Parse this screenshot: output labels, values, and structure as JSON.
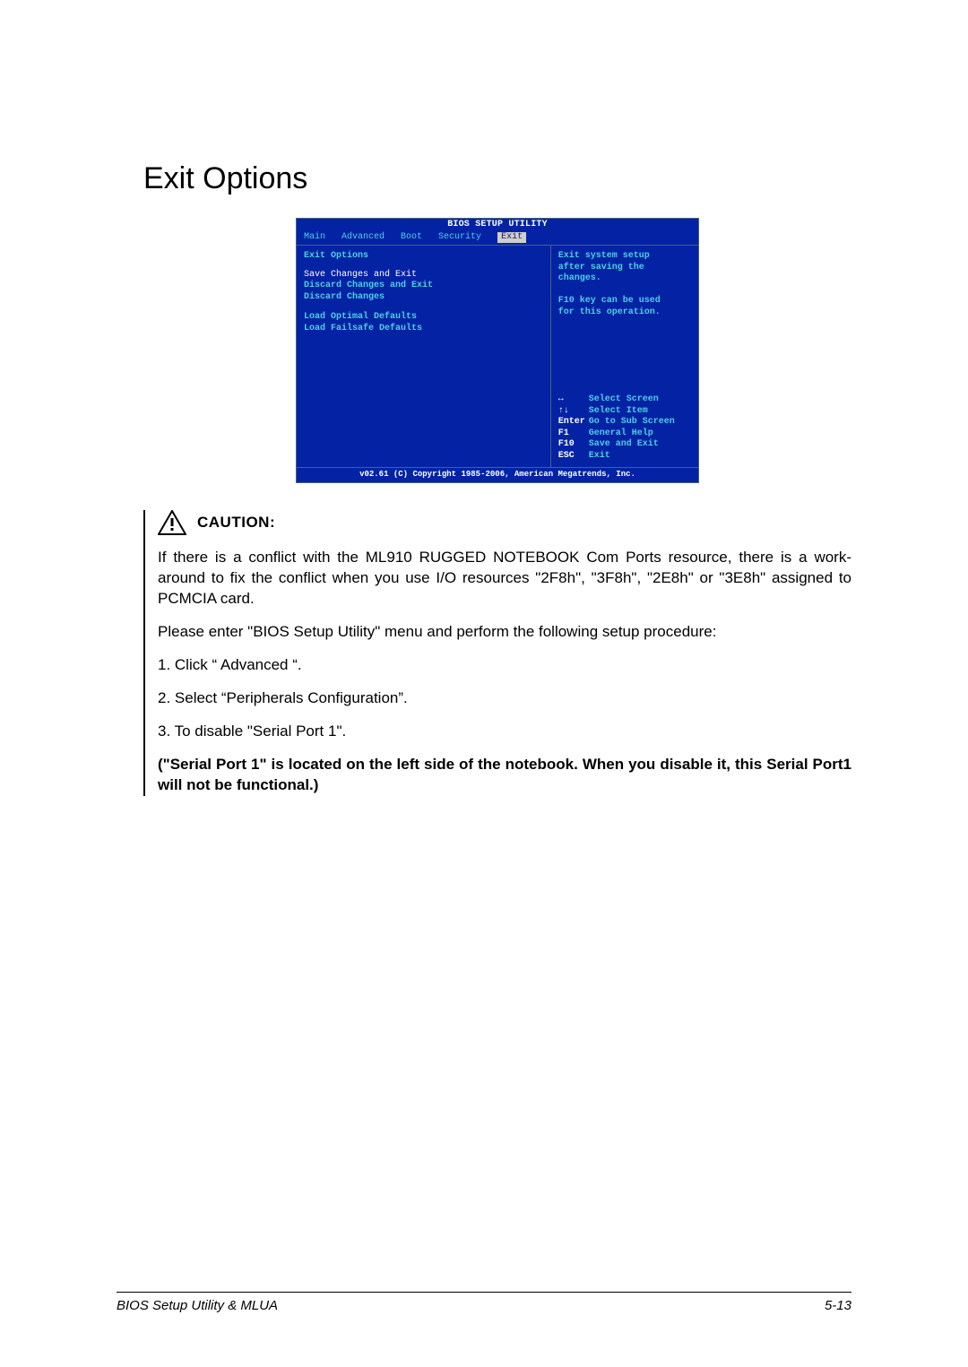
{
  "title": "Exit Options",
  "bios": {
    "title": "BIOS SETUP UTILITY",
    "menubar": {
      "items": [
        "Main",
        "Advanced",
        "Boot",
        "Security"
      ],
      "selected": "Exit"
    },
    "left": {
      "heading": "Exit Options",
      "options": [
        {
          "label": "Save Changes and Exit",
          "selected": true
        },
        {
          "label": "Discard Changes and Exit",
          "selected": false
        },
        {
          "label": "Discard Changes",
          "selected": false
        }
      ],
      "options2": [
        {
          "label": "Load Optimal Defaults"
        },
        {
          "label": "Load Failsafe Defaults"
        }
      ]
    },
    "right": {
      "help": [
        "Exit system setup",
        "after saving the",
        "changes.",
        "",
        "F10 key can be used",
        "for this operation."
      ],
      "keys": [
        {
          "k": "↔",
          "d": "Select Screen"
        },
        {
          "k": "↑↓",
          "d": "Select Item"
        },
        {
          "k": "Enter",
          "d": "Go to Sub Screen"
        },
        {
          "k": "F1",
          "d": "General Help"
        },
        {
          "k": "F10",
          "d": "Save and Exit"
        },
        {
          "k": "ESC",
          "d": "Exit"
        }
      ]
    },
    "footer": "v02.61 (C) Copyright 1985-2006, American Megatrends, Inc."
  },
  "caution": {
    "label": "CAUTION:",
    "p1": "If there is a conflict with the ML910 RUGGED NOTEBOOK Com Ports resource, there is a work-around to fix the conflict when you use I/O resources \"2F8h\", \"3F8h\", \"2E8h\" or \"3E8h\" assigned to PCMCIA card.",
    "p2": "Please enter \"BIOS Setup Utility\" menu and perform the following setup procedure:",
    "l1": "1. Click “ Advanced “.",
    "l2": "2. Select “Peripherals Configuration”.",
    "l3": "3. To disable \"Serial Port 1\".",
    "bold": "(\"Serial Port 1\" is located on the left side of the notebook. When you disable it, this Serial Port1 will not be functional.)"
  },
  "footer": {
    "left": "BIOS Setup Utility & MLUA",
    "right": "5-13"
  }
}
